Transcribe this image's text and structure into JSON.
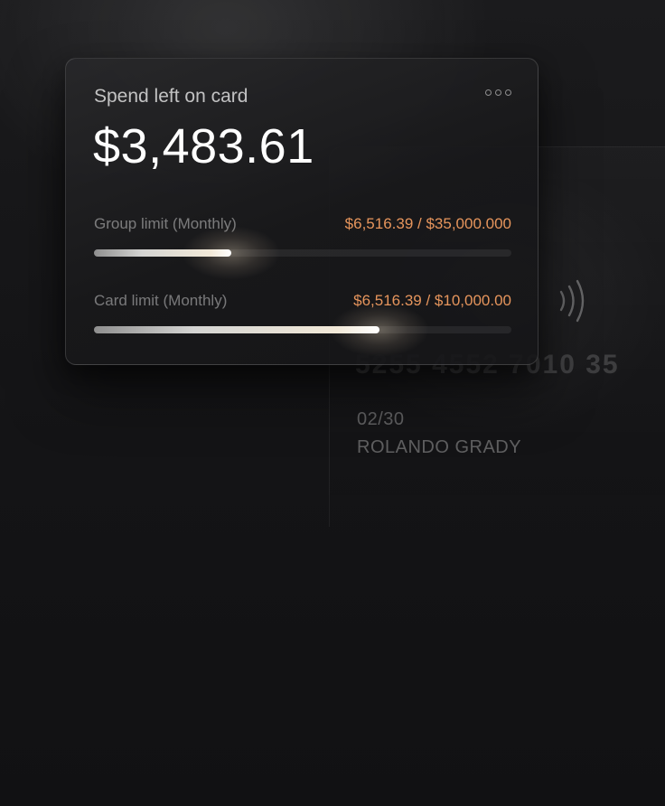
{
  "widget": {
    "title": "Spend left on card",
    "balance": "$3,483.61",
    "more_icon": "more-horizontal-icon",
    "limits": [
      {
        "label": "Group limit (Monthly)",
        "value": "$6,516.39 / $35,000.000",
        "progress_fraction": 0.33
      },
      {
        "label": "Card limit (Monthly)",
        "value": "$6,516.39 / $10,000.00",
        "progress_fraction": 0.685
      }
    ]
  },
  "card": {
    "number": "5255 4552 7010 35",
    "expiry": "02/30",
    "holder": "ROLANDO GRADY",
    "contactless_icon": "contactless-icon"
  },
  "colors": {
    "accent": "#e6955c",
    "background": "#141416"
  }
}
